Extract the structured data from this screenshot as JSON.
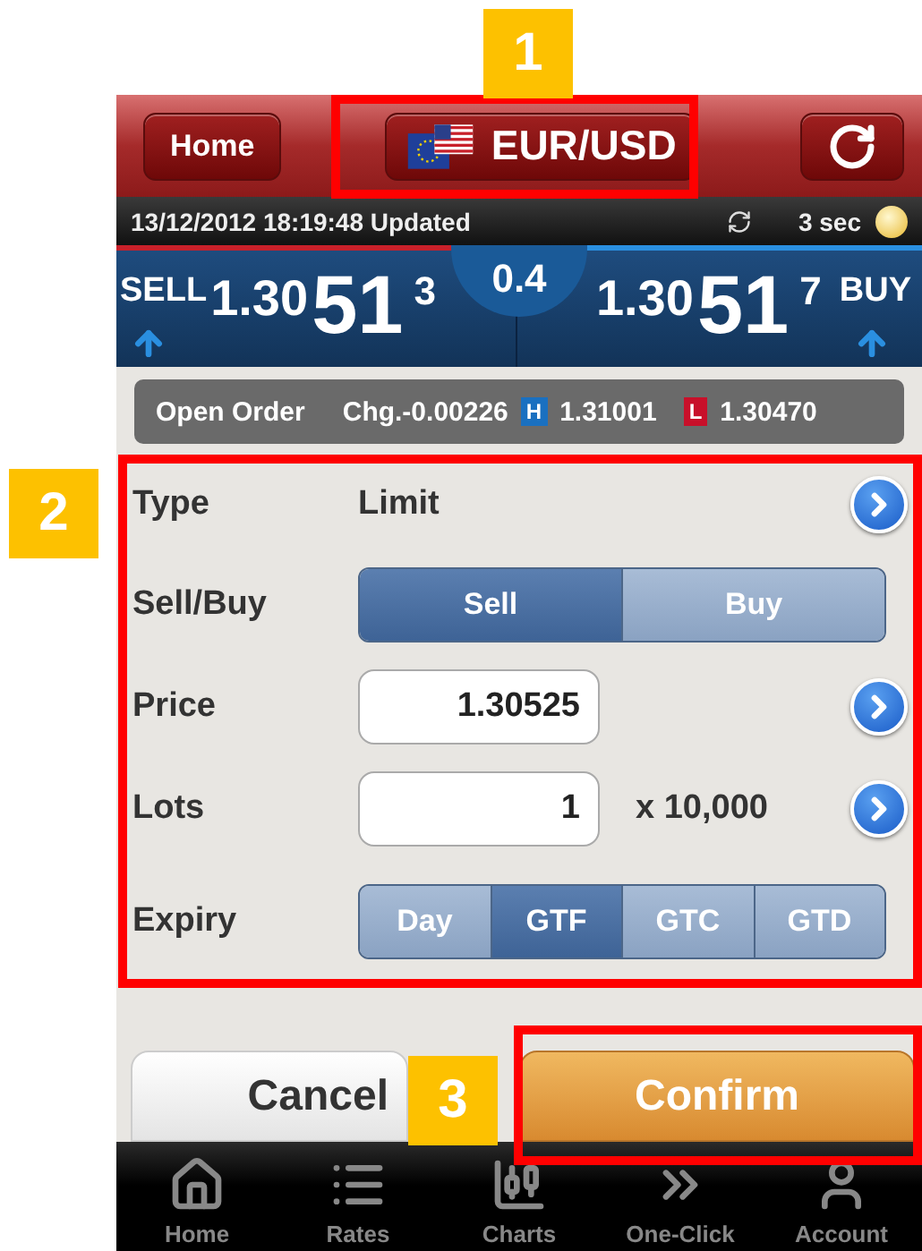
{
  "header": {
    "home_button": "Home",
    "pair": "EUR/USD"
  },
  "status_bar": {
    "timestamp": "13/12/2012 18:19:48 Updated",
    "interval": "3 sec"
  },
  "quotes": {
    "sell": {
      "label": "SELL",
      "big": "1.30",
      "pips": "51",
      "fraction": "3"
    },
    "spread": "0.4",
    "buy": {
      "label": "BUY",
      "big": "1.30",
      "pips": "51",
      "fraction": "7"
    }
  },
  "summary": {
    "label": "Open Order",
    "change": "Chg.-0.00226",
    "high": {
      "badge": "H",
      "value": "1.31001"
    },
    "low": {
      "badge": "L",
      "value": "1.30470"
    }
  },
  "form": [
    {
      "kind": "text",
      "label": "Type",
      "value": "Limit",
      "more": true
    },
    {
      "kind": "segmented",
      "label": "Sell/Buy",
      "options": [
        {
          "label": "Sell",
          "selected": true
        },
        {
          "label": "Buy",
          "selected": false
        }
      ]
    },
    {
      "kind": "input",
      "label": "Price",
      "value": "1.30525",
      "more": true
    },
    {
      "kind": "input",
      "label": "Lots",
      "value": "1",
      "suffix": "x 10,000",
      "more": true
    },
    {
      "kind": "segmented",
      "label": "Expiry",
      "options": [
        {
          "label": "Day",
          "selected": false
        },
        {
          "label": "GTF",
          "selected": true
        },
        {
          "label": "GTC",
          "selected": false
        },
        {
          "label": "GTD",
          "selected": false
        }
      ]
    }
  ],
  "buttons": {
    "cancel": "Cancel",
    "confirm": "Confirm"
  },
  "tab_bar": [
    {
      "label": "Home"
    },
    {
      "label": "Rates"
    },
    {
      "label": "Charts"
    },
    {
      "label": "One-Click"
    },
    {
      "label": "Account"
    }
  ],
  "annotations": [
    {
      "label": "1"
    },
    {
      "label": "2"
    },
    {
      "label": "3"
    }
  ]
}
